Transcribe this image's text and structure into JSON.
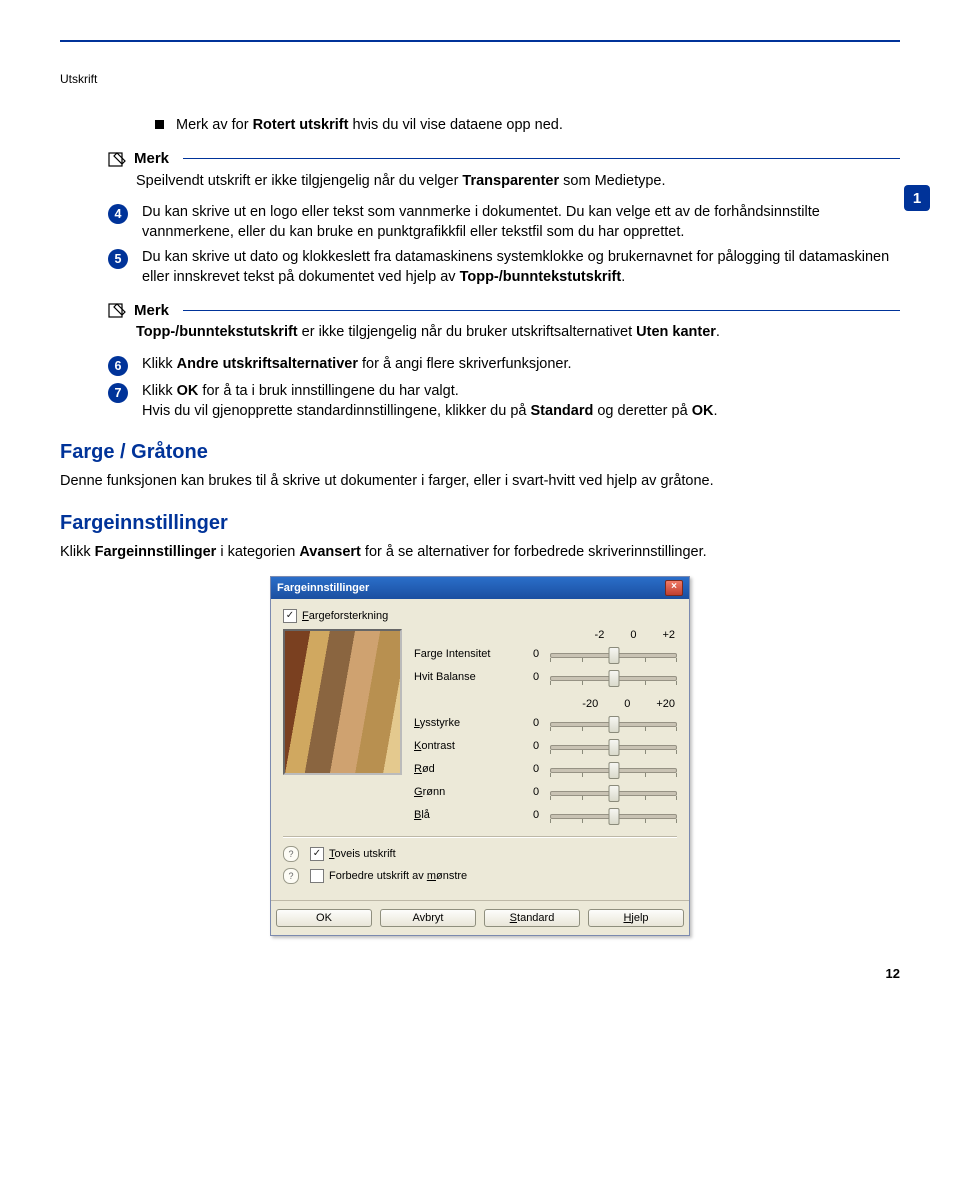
{
  "header": {
    "section": "Utskrift"
  },
  "sideTab": "1",
  "bullet": {
    "text_before": "Merk av for ",
    "bold": "Rotert utskrift",
    "text_after": " hvis du vil vise dataene opp ned."
  },
  "note1": {
    "label": "Merk",
    "body_before": "Speilvendt utskrift er ikke tilgjengelig når du velger ",
    "bold": "Transparenter",
    "body_after": " som Medietype."
  },
  "step4": {
    "num": "4",
    "text": "Du kan skrive ut en logo eller tekst som vannmerke i dokumentet. Du kan velge ett av de forhåndsinnstilte vannmerkene, eller du kan bruke en punktgrafikkfil eller tekstfil som du har opprettet."
  },
  "step5": {
    "num": "5",
    "text_before": "Du kan skrive ut dato og klokkeslett fra datamaskinens systemklokke og brukernavnet for pålogging til datamaskinen eller innskrevet tekst på dokumentet ved hjelp av ",
    "bold": "Topp-/bunntekstutskrift",
    "text_after": "."
  },
  "note2": {
    "label": "Merk",
    "bold1": "Topp-/bunntekstutskrift",
    "mid": " er ikke tilgjengelig når du bruker utskriftsalternativet ",
    "bold2": "Uten kanter",
    "after": "."
  },
  "step6": {
    "num": "6",
    "before": "Klikk ",
    "bold": "Andre utskriftsalternativer",
    "after": " for å angi flere skriverfunksjoner."
  },
  "step7": {
    "num": "7",
    "line1_before": "Klikk ",
    "line1_bold": "OK",
    "line1_after": " for å ta i bruk innstillingene du har valgt.",
    "line2_before": "Hvis du vil gjenopprette standardinnstillingene, klikker du på ",
    "line2_bold1": "Standard",
    "line2_mid": " og deretter på ",
    "line2_bold2": "OK",
    "line2_after": "."
  },
  "h_farge": "Farge / Gråtone",
  "p_farge": "Denne funksjonen kan brukes til å skrive ut dokumenter i farger, eller i svart-hvitt ved hjelp av gråtone.",
  "h_fargeinnst": "Fargeinnstillinger",
  "p_fargeinnst_before": "Klikk ",
  "p_fargeinnst_bold1": "Fargeinnstillinger",
  "p_fargeinnst_mid": " i kategorien ",
  "p_fargeinnst_bold2": "Avansert",
  "p_fargeinnst_after": " for å se alternativer for forbedrede skriverinnstillinger.",
  "dialog": {
    "title": "Fargeinnstillinger",
    "close": "×",
    "chk_fargefor": "Fargeforsterkning",
    "topScale": {
      "a": "-2",
      "b": "0",
      "c": "+2"
    },
    "row_int": {
      "name": "Farge Intensitet",
      "val": "0"
    },
    "row_hvit": {
      "name": "Hvit Balanse",
      "val": "0"
    },
    "lowScale": {
      "a": "-20",
      "b": "0",
      "c": "+20"
    },
    "row_lys": {
      "name": "Lysstyrke",
      "val": "0"
    },
    "row_kon": {
      "name": "Kontrast",
      "val": "0"
    },
    "row_rod": {
      "name": "Rød",
      "val": "0"
    },
    "row_gro": {
      "name": "Grønn",
      "val": "0"
    },
    "row_bla": {
      "name": "Blå",
      "val": "0"
    },
    "chk_toveis": "Toveis utskrift",
    "chk_monst": "Forbedre utskrift av mønstre",
    "btn_ok": "OK",
    "btn_avbryt": "Avbryt",
    "btn_standard": "Standard",
    "btn_hjelp": "Hjelp"
  },
  "pageNumber": "12"
}
